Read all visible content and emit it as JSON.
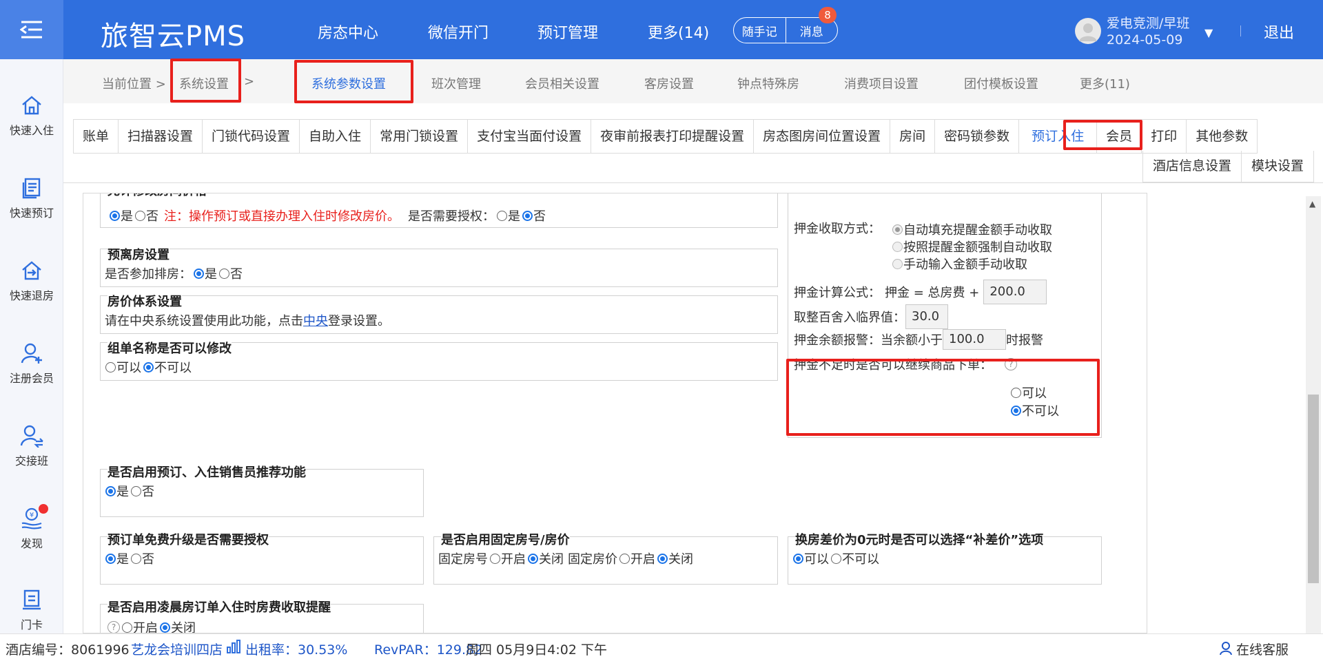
{
  "header": {
    "logo": "旅智云PMS",
    "nav": [
      "房态中心",
      "微信开门",
      "预订管理",
      "更多(14)"
    ],
    "memo": "随手记",
    "messages": "消息",
    "badge": "8",
    "user": "爱电竞测/早班",
    "date": "2024-05-09",
    "logout": "退出"
  },
  "sidebar": [
    "快速入住",
    "快速预订",
    "快速退房",
    "注册会员",
    "交接班",
    "发现",
    "门卡"
  ],
  "breadcrumb": {
    "prefix": "当前位置 >",
    "current": "系统设置",
    "suffix": ">",
    "tabs": [
      "系统参数设置",
      "班次管理",
      "会员相关设置",
      "客房设置",
      "钟点特殊房",
      "消费项目设置",
      "团付模板设置",
      "更多(11)"
    ]
  },
  "subtabs": [
    "账单",
    "扫描器设置",
    "门锁代码设置",
    "自助入住",
    "常用门锁设置",
    "支付宝当面付设置",
    "夜审前报表打印提醒设置",
    "房态图房间位置设置",
    "房间",
    "密码锁参数",
    "预订入住",
    "会员",
    "打印",
    "其他参数"
  ],
  "subtabs2": [
    "酒店信息设置",
    "模块设置"
  ],
  "content": {
    "s1": {
      "title": "允许修改房间价格",
      "yes": "是",
      "no": "否",
      "note": "注：操作预订或直接办理入住时修改房价。",
      "auth_q": "是否需要授权：",
      "yes2": "是",
      "no2": "否"
    },
    "s2": {
      "title": "预离房设置",
      "q": "是否参加排房：",
      "yes": "是",
      "no": "否"
    },
    "s3": {
      "title": "房价体系设置",
      "text_a": "请在中央系统设置使用此功能，点击",
      "link": "中央",
      "text_b": "登录设置。"
    },
    "s4": {
      "title": "组单名称是否可以修改",
      "opt1": "可以",
      "opt2": "不可以"
    },
    "dep": {
      "method_label": "押金收取方式：",
      "m1": "自动填充提醒金额手动收取",
      "m2": "按照提醒金额强制自动收取",
      "m3": "手动输入金额手动收取",
      "formula_label": "押金计算公式：",
      "formula": "押金 = 总房费 +",
      "formula_val": "200.0",
      "round_label": "取整百舍入临界值：",
      "round_val": "30.0",
      "alarm_label": "押金余额报警：当余额小于",
      "alarm_val": "100.0",
      "alarm_tail": "时报警",
      "insuf_label": "押金不足时是否可以继续商品下单：",
      "help": "?",
      "can": "可以",
      "cannot": "不可以"
    },
    "s5": {
      "title": "是否启用预订、入住销售员推荐功能",
      "yes": "是",
      "no": "否"
    },
    "s6": {
      "title": "预订单免费升级是否需要授权",
      "yes": "是",
      "no": "否"
    },
    "s7": {
      "title": "是否启用固定房号/房价",
      "l1": "固定房号",
      "on": "开启",
      "off": "关闭",
      "l2": "固定房价",
      "on2": "开启",
      "off2": "关闭"
    },
    "s8": {
      "title": "换房差价为0元时是否可以选择“补差价”选项",
      "can": "可以",
      "cannot": "不可以"
    },
    "s9": {
      "title": "是否启用凌晨房订单入住时房费收取提醒",
      "help": "?",
      "on": "开启",
      "off": "关闭"
    }
  },
  "status": {
    "hotel_no": "酒店编号：8061996",
    "hotel_name": "艺龙会培训四店",
    "occ": "出租率：30.53%",
    "revpar": "RevPAR：129.82",
    "datetime": "周四 05月9日4:02 下午",
    "service": "在线客服"
  }
}
